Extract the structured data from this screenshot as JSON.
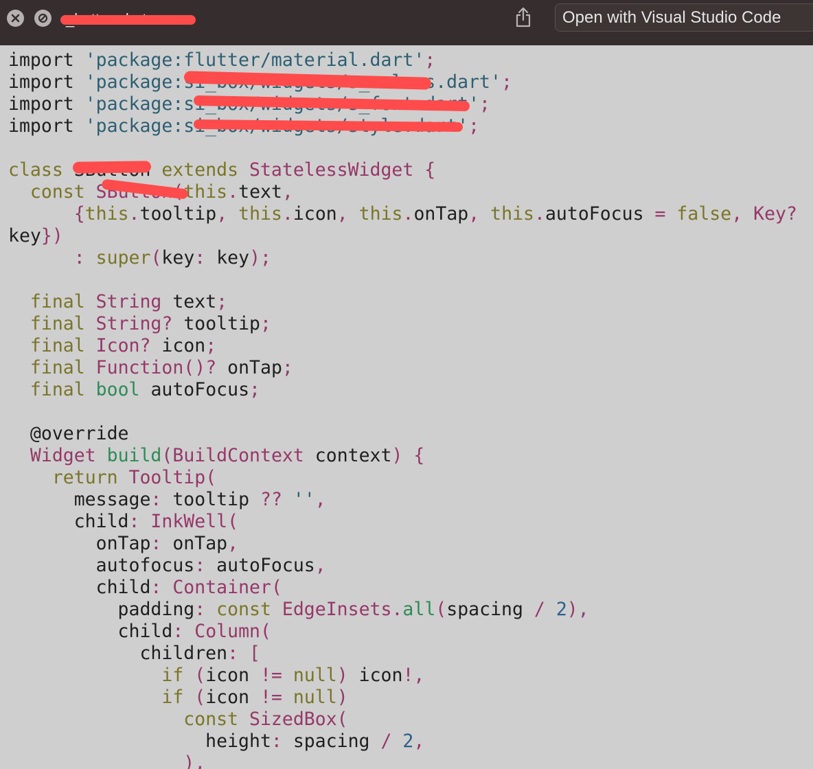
{
  "titlebar": {
    "filename": "_button.dart",
    "open_with_label": "Open with Visual Studio Code",
    "icons": [
      "close-icon",
      "block-icon",
      "share-icon"
    ]
  },
  "colors": {
    "titlebar_bg": "#362e2e",
    "editor_bg": "#cfcfcf",
    "keyword": "#7a7528",
    "string": "#2e5f73",
    "type": "#963869",
    "function": "#2e8b57",
    "number": "#2d5f8a",
    "redaction": "#ff4b4b"
  },
  "code": {
    "lines": [
      [
        [
          "pl",
          "import "
        ],
        [
          "str",
          "'package:flutter/material.dart'"
        ],
        [
          "op",
          ";"
        ]
      ],
      [
        [
          "pl",
          "import "
        ],
        [
          "str",
          "'package:si_box/widgets/s_colors.dart'"
        ],
        [
          "op",
          ";"
        ]
      ],
      [
        [
          "pl",
          "import "
        ],
        [
          "str",
          "'package:si_box/widgets/s_font.dart'"
        ],
        [
          "op",
          ";"
        ]
      ],
      [
        [
          "pl",
          "import "
        ],
        [
          "str",
          "'package:si_box/widgets/style.dart'"
        ],
        [
          "op",
          ";"
        ]
      ],
      [],
      [
        [
          "kw",
          "class "
        ],
        [
          "pl",
          "SButton "
        ],
        [
          "kw",
          "extends "
        ],
        [
          "ty",
          "StatelessWidget "
        ],
        [
          "op",
          "{"
        ]
      ],
      [
        [
          "pl",
          "  "
        ],
        [
          "kw",
          "const "
        ],
        [
          "ty",
          "SButton"
        ],
        [
          "op",
          "("
        ],
        [
          "kw",
          "this"
        ],
        [
          "op",
          "."
        ],
        [
          "pl",
          "text"
        ],
        [
          "op",
          ","
        ]
      ],
      [
        [
          "pl",
          "      "
        ],
        [
          "op",
          "{"
        ],
        [
          "kw",
          "this"
        ],
        [
          "op",
          "."
        ],
        [
          "pl",
          "tooltip"
        ],
        [
          "op",
          ", "
        ],
        [
          "kw",
          "this"
        ],
        [
          "op",
          "."
        ],
        [
          "pl",
          "icon"
        ],
        [
          "op",
          ", "
        ],
        [
          "kw",
          "this"
        ],
        [
          "op",
          "."
        ],
        [
          "pl",
          "onTap"
        ],
        [
          "op",
          ", "
        ],
        [
          "kw",
          "this"
        ],
        [
          "op",
          "."
        ],
        [
          "pl",
          "autoFocus "
        ],
        [
          "op",
          "= "
        ],
        [
          "kw",
          "false"
        ],
        [
          "op",
          ", "
        ],
        [
          "ty",
          "Key"
        ],
        [
          "op",
          "?"
        ]
      ],
      [
        [
          "pl",
          "key"
        ],
        [
          "op",
          "})"
        ]
      ],
      [
        [
          "pl",
          "      "
        ],
        [
          "op",
          ": "
        ],
        [
          "kw",
          "super"
        ],
        [
          "op",
          "("
        ],
        [
          "pl",
          "key"
        ],
        [
          "op",
          ": "
        ],
        [
          "pl",
          "key"
        ],
        [
          "op",
          ");"
        ]
      ],
      [],
      [
        [
          "pl",
          "  "
        ],
        [
          "kw",
          "final "
        ],
        [
          "ty",
          "String "
        ],
        [
          "pl",
          "text"
        ],
        [
          "op",
          ";"
        ]
      ],
      [
        [
          "pl",
          "  "
        ],
        [
          "kw",
          "final "
        ],
        [
          "ty",
          "String"
        ],
        [
          "op",
          "? "
        ],
        [
          "pl",
          "tooltip"
        ],
        [
          "op",
          ";"
        ]
      ],
      [
        [
          "pl",
          "  "
        ],
        [
          "kw",
          "final "
        ],
        [
          "ty",
          "Icon"
        ],
        [
          "op",
          "? "
        ],
        [
          "pl",
          "icon"
        ],
        [
          "op",
          ";"
        ]
      ],
      [
        [
          "pl",
          "  "
        ],
        [
          "kw",
          "final "
        ],
        [
          "ty",
          "Function"
        ],
        [
          "op",
          "()? "
        ],
        [
          "pl",
          "onTap"
        ],
        [
          "op",
          ";"
        ]
      ],
      [
        [
          "pl",
          "  "
        ],
        [
          "kw",
          "final "
        ],
        [
          "fn",
          "bool "
        ],
        [
          "pl",
          "autoFocus"
        ],
        [
          "op",
          ";"
        ]
      ],
      [],
      [
        [
          "pl",
          "  @override"
        ]
      ],
      [
        [
          "pl",
          "  "
        ],
        [
          "ty",
          "Widget "
        ],
        [
          "fn",
          "build"
        ],
        [
          "op",
          "("
        ],
        [
          "ty",
          "BuildContext "
        ],
        [
          "pl",
          "context"
        ],
        [
          "op",
          ") {"
        ]
      ],
      [
        [
          "pl",
          "    "
        ],
        [
          "kw",
          "return "
        ],
        [
          "ty",
          "Tooltip"
        ],
        [
          "op",
          "("
        ]
      ],
      [
        [
          "pl",
          "      message"
        ],
        [
          "op",
          ": "
        ],
        [
          "pl",
          "tooltip "
        ],
        [
          "op",
          "?? "
        ],
        [
          "str",
          "''"
        ],
        [
          "op",
          ","
        ]
      ],
      [
        [
          "pl",
          "      child"
        ],
        [
          "op",
          ": "
        ],
        [
          "ty",
          "InkWell"
        ],
        [
          "op",
          "("
        ]
      ],
      [
        [
          "pl",
          "        onTap"
        ],
        [
          "op",
          ": "
        ],
        [
          "pl",
          "onTap"
        ],
        [
          "op",
          ","
        ]
      ],
      [
        [
          "pl",
          "        autofocus"
        ],
        [
          "op",
          ": "
        ],
        [
          "pl",
          "autoFocus"
        ],
        [
          "op",
          ","
        ]
      ],
      [
        [
          "pl",
          "        child"
        ],
        [
          "op",
          ": "
        ],
        [
          "ty",
          "Container"
        ],
        [
          "op",
          "("
        ]
      ],
      [
        [
          "pl",
          "          padding"
        ],
        [
          "op",
          ": "
        ],
        [
          "kw",
          "const "
        ],
        [
          "ty",
          "EdgeInsets"
        ],
        [
          "op",
          "."
        ],
        [
          "fn",
          "all"
        ],
        [
          "op",
          "("
        ],
        [
          "pl",
          "spacing "
        ],
        [
          "op",
          "/ "
        ],
        [
          "num",
          "2"
        ],
        [
          "op",
          "),"
        ]
      ],
      [
        [
          "pl",
          "          child"
        ],
        [
          "op",
          ": "
        ],
        [
          "ty",
          "Column"
        ],
        [
          "op",
          "("
        ]
      ],
      [
        [
          "pl",
          "            children"
        ],
        [
          "op",
          ": ["
        ]
      ],
      [
        [
          "pl",
          "              "
        ],
        [
          "kw",
          "if "
        ],
        [
          "op",
          "("
        ],
        [
          "pl",
          "icon "
        ],
        [
          "op",
          "!= "
        ],
        [
          "kw",
          "null"
        ],
        [
          "op",
          ") "
        ],
        [
          "pl",
          "icon"
        ],
        [
          "op",
          "!,"
        ]
      ],
      [
        [
          "pl",
          "              "
        ],
        [
          "kw",
          "if "
        ],
        [
          "op",
          "("
        ],
        [
          "pl",
          "icon "
        ],
        [
          "op",
          "!= "
        ],
        [
          "kw",
          "null"
        ],
        [
          "op",
          ")"
        ]
      ],
      [
        [
          "pl",
          "                "
        ],
        [
          "kw",
          "const "
        ],
        [
          "ty",
          "SizedBox"
        ],
        [
          "op",
          "("
        ]
      ],
      [
        [
          "pl",
          "                  height"
        ],
        [
          "op",
          ": "
        ],
        [
          "pl",
          "spacing "
        ],
        [
          "op",
          "/ "
        ],
        [
          "num",
          "2"
        ],
        [
          "op",
          ","
        ]
      ],
      [
        [
          "pl",
          "                "
        ],
        [
          "op",
          "),"
        ]
      ]
    ]
  }
}
